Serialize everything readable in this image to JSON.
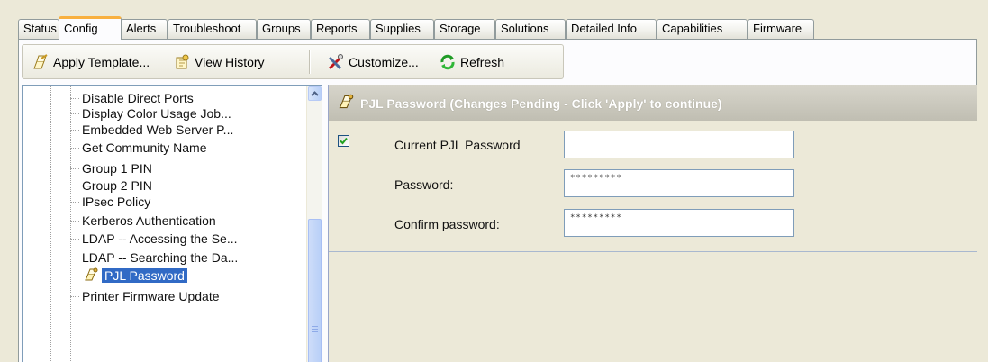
{
  "tabs": [
    {
      "label": "Status",
      "active": false
    },
    {
      "label": "Config",
      "active": true
    },
    {
      "label": "Alerts",
      "active": false
    },
    {
      "label": "Troubleshoot",
      "active": false
    },
    {
      "label": "Groups",
      "active": false
    },
    {
      "label": "Reports",
      "active": false
    },
    {
      "label": "Supplies",
      "active": false
    },
    {
      "label": "Storage",
      "active": false
    },
    {
      "label": "Solutions",
      "active": false
    },
    {
      "label": "Detailed Info",
      "active": false
    },
    {
      "label": "Capabilities",
      "active": false
    },
    {
      "label": "Firmware",
      "active": false
    }
  ],
  "toolbar": {
    "apply_template": "Apply Template...",
    "view_history": "View History",
    "customize": "Customize...",
    "refresh": "Refresh"
  },
  "tree": {
    "items": [
      "Disable Direct Ports",
      "Display Color Usage Job...",
      "Embedded Web Server P...",
      "Get Community Name",
      "Group 1 PIN",
      "Group 2 PIN",
      "IPsec Policy",
      "Kerberos Authentication",
      "LDAP -- Accessing the Se...",
      "LDAP -- Searching the Da...",
      "PJL Password",
      "Printer Firmware Update"
    ],
    "selected": "PJL Password"
  },
  "panel": {
    "title": "PJL Password (Changes Pending - Click 'Apply' to continue)",
    "enabled_checked": true,
    "fields": {
      "current": {
        "label": "Current PJL Password",
        "value": ""
      },
      "password": {
        "label": "Password:",
        "value": "*********"
      },
      "confirm": {
        "label": "Confirm password:",
        "value": "*********"
      }
    }
  },
  "icons": {
    "apply_template": "apply-template-icon",
    "view_history": "view-history-icon",
    "customize": "customize-tools-icon",
    "refresh": "refresh-icon",
    "pjl": "pjl-password-icon",
    "scroll_up": "chevron-up-icon"
  },
  "colors": {
    "selection": "#316ac5",
    "active_tab_accent": "#f8b040",
    "header_band": "#c8c6ba",
    "window_face": "#ece9d8",
    "check_green": "#21a121"
  }
}
